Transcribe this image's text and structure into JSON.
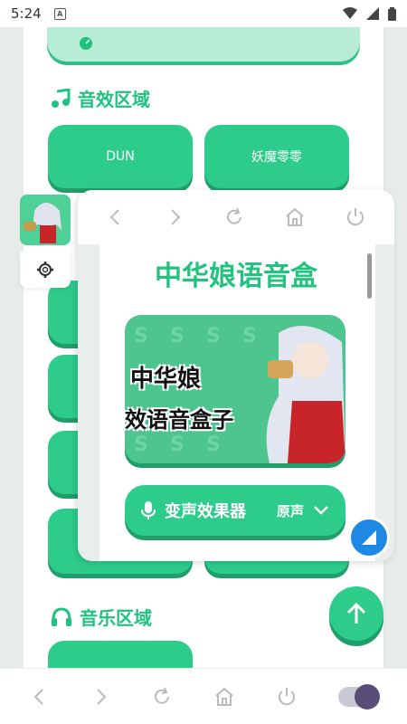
{
  "status_bar": {
    "time": "5:24"
  },
  "sections": {
    "sound_effects": {
      "title": "音效区域"
    },
    "music": {
      "title": "音乐区域"
    }
  },
  "sound_buttons": [
    {
      "label": "DUN"
    },
    {
      "label": "妖魔零零"
    }
  ],
  "floating_window": {
    "title": "中华娘语音盒",
    "banner": {
      "line1": "中华娘",
      "line2": "效语音盒子"
    },
    "voice_changer": {
      "label": "变声效果器",
      "value": "原声"
    }
  },
  "colors": {
    "accent": "#2ecc8b",
    "accent_dark": "#1e9e68",
    "title": "#23c27f",
    "resize": "#1e88e5"
  }
}
